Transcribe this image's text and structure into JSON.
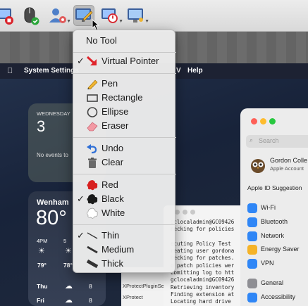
{
  "toolbar": {
    "buttons": [
      {
        "name": "stop-sharing",
        "icon": "monitor-stop-icon"
      },
      {
        "name": "mouse-control",
        "icon": "mouse-check-icon"
      },
      {
        "name": "user-settings",
        "icon": "user-gear-icon"
      },
      {
        "name": "annotation-tools",
        "icon": "monitor-pencil-icon"
      },
      {
        "name": "power",
        "icon": "monitor-power-icon"
      },
      {
        "name": "display",
        "icon": "monitor-display-icon"
      }
    ]
  },
  "menu": {
    "no_tool": "No Tool",
    "virtual_pointer": "Virtual Pointer",
    "pen": "Pen",
    "rectangle": "Rectangle",
    "ellipse": "Ellipse",
    "eraser": "Eraser",
    "undo": "Undo",
    "clear": "Clear",
    "red": "Red",
    "black": "Black",
    "white": "White",
    "thin": "Thin",
    "medium": "Medium",
    "thick": "Thick",
    "checkmark": "✓",
    "checked": [
      "Virtual Pointer",
      "Black",
      "Thin"
    ]
  },
  "remote": {
    "menubar": {
      "app": "System Settings",
      "help": "Help",
      "view_fragment": "V"
    },
    "calendar": {
      "day": "WEDNESDAY",
      "date": "3",
      "empty": "No events to"
    },
    "weather": {
      "city": "Wenham",
      "temp": "80°",
      "hours": [
        {
          "time": "4PM",
          "temp": "79°"
        },
        {
          "time": "5",
          "temp": "78°"
        }
      ],
      "days": [
        {
          "day": "Thu",
          "high": "8"
        },
        {
          "day": "Fri",
          "high": "8"
        }
      ]
    },
    "terminal": {
      "lines": [
        "gclocaladmin@GC09426",
        "hecking for policies",
        "",
        "ecuting Policy Test",
        "reating user gordona",
        "hecking for patches.",
        "o patch policies wer",
        "ubmitting log to htt",
        "gclocaladmin@GC09426",
        "Retrieving inventory",
        "Finding extension at",
        "Locating hard drive",
        "Locating accounts"
      ]
    },
    "xlist": [
      "XProtectPluginSe",
      "XProtect"
    ],
    "settings": {
      "search_placeholder": "Search",
      "account_name": "Gordon Colle",
      "account_sub": "Apple Account",
      "apple_id": "Apple ID Suggestion",
      "items": [
        {
          "label": "Wi-Fi",
          "color": "#2f86f6"
        },
        {
          "label": "Bluetooth",
          "color": "#2f86f6"
        },
        {
          "label": "Network",
          "color": "#2f86f6"
        },
        {
          "label": "Energy Saver",
          "color": "#f5b328"
        },
        {
          "label": "VPN",
          "color": "#2f86f6"
        },
        {
          "label": "General",
          "color": "#8e8e93"
        },
        {
          "label": "Accessibility",
          "color": "#2f86f6"
        }
      ]
    }
  }
}
